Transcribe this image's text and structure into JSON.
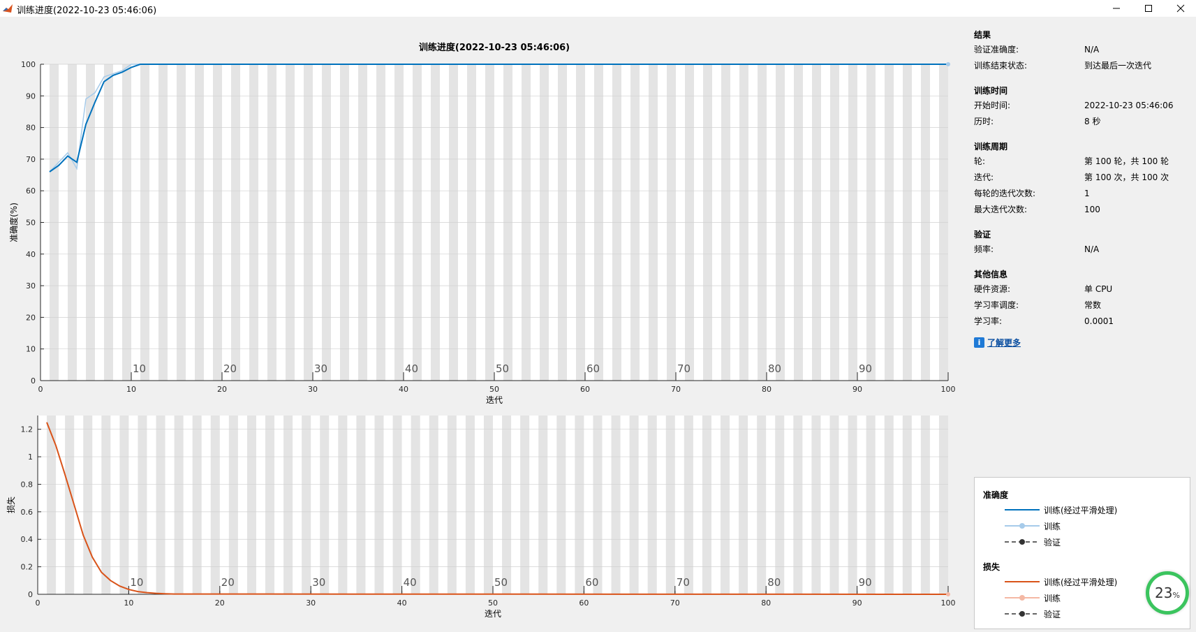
{
  "window": {
    "title": "训练进度(2022-10-23 05:46:06)",
    "minimize_icon": "minimize-icon",
    "maximize_icon": "maximize-icon",
    "close_icon": "close-icon"
  },
  "results": {
    "title": "结果",
    "rows": [
      {
        "key": "验证准确度:",
        "value": "N/A"
      },
      {
        "key": "训练结束状态:",
        "value": "到达最后一次迭代"
      }
    ]
  },
  "time": {
    "title": "训练时间",
    "rows": [
      {
        "key": "开始时间:",
        "value": "2022-10-23 05:46:06"
      },
      {
        "key": "历时:",
        "value": "8 秒"
      }
    ]
  },
  "cycle": {
    "title": "训练周期",
    "rows": [
      {
        "key": "轮:",
        "value": "第 100 轮，共 100 轮"
      },
      {
        "key": "迭代:",
        "value": "第 100 次，共 100 次"
      },
      {
        "key": "每轮的迭代次数:",
        "value": "1"
      },
      {
        "key": "最大迭代次数:",
        "value": "100"
      }
    ]
  },
  "validation": {
    "title": "验证",
    "rows": [
      {
        "key": "频率:",
        "value": "N/A"
      }
    ]
  },
  "other": {
    "title": "其他信息",
    "rows": [
      {
        "key": "硬件资源:",
        "value": "单 CPU"
      },
      {
        "key": "学习率调度:",
        "value": "常数"
      },
      {
        "key": "学习率:",
        "value": "0.0001"
      }
    ]
  },
  "learn_more": "了解更多",
  "legend": {
    "accuracy_title": "准确度",
    "loss_title": "损失",
    "smoothed": "训练(经过平滑处理)",
    "train": "训练",
    "validation": "验证"
  },
  "badge": {
    "value": "23",
    "unit": "%"
  },
  "colors": {
    "accuracy_smoothed": "#0072BD",
    "accuracy_raw": "#A6CBEA",
    "loss_smoothed": "#D95319",
    "loss_raw": "#F4B8A4",
    "validation": "#333333",
    "epoch_band": "#e4e4e4",
    "badge_ring": "#3bc45e"
  },
  "chart_data": [
    {
      "type": "line",
      "title": "训练进度(2022-10-23 05:46:06)",
      "xlabel": "迭代",
      "ylabel": "准确度(%)",
      "xlim": [
        0,
        100
      ],
      "ylim": [
        0,
        100
      ],
      "xticks": [
        0,
        10,
        20,
        30,
        40,
        50,
        60,
        70,
        80,
        90,
        100
      ],
      "yticks": [
        0,
        10,
        20,
        30,
        40,
        50,
        60,
        70,
        80,
        90,
        100
      ],
      "epoch_labels": [
        10,
        20,
        30,
        40,
        50,
        60,
        70,
        80,
        90
      ],
      "grid": true,
      "series": [
        {
          "x": [
            1,
            2,
            3,
            4,
            5,
            6,
            7,
            8,
            9,
            10,
            11,
            12,
            100
          ],
          "values": [
            66,
            68,
            71,
            69,
            81,
            88,
            94.5,
            96.5,
            97.5,
            99,
            100,
            100,
            100
          ]
        },
        {
          "x": [
            1,
            2,
            3,
            4,
            5,
            6,
            7,
            8,
            9,
            10,
            11,
            100
          ],
          "values": [
            66,
            69,
            72,
            67,
            89,
            91,
            96,
            97,
            98,
            100,
            100,
            100
          ]
        }
      ]
    },
    {
      "type": "line",
      "xlabel": "迭代",
      "ylabel": "损失",
      "xlim": [
        0,
        100
      ],
      "ylim": [
        0,
        1.3
      ],
      "xticks": [
        0,
        10,
        20,
        30,
        40,
        50,
        60,
        70,
        80,
        90,
        100
      ],
      "yticks": [
        0,
        0.2,
        0.4,
        0.6,
        0.8,
        1,
        1.2
      ],
      "epoch_labels": [
        10,
        20,
        30,
        40,
        50,
        60,
        70,
        80,
        90
      ],
      "grid": true,
      "series": [
        {
          "x": [
            1,
            2,
            3,
            4,
            5,
            6,
            7,
            8,
            9,
            10,
            11,
            12,
            13,
            14,
            15,
            100
          ],
          "values": [
            1.25,
            1.08,
            0.87,
            0.65,
            0.43,
            0.27,
            0.16,
            0.1,
            0.06,
            0.035,
            0.02,
            0.012,
            0.007,
            0.004,
            0.002,
            0
          ]
        }
      ]
    }
  ]
}
